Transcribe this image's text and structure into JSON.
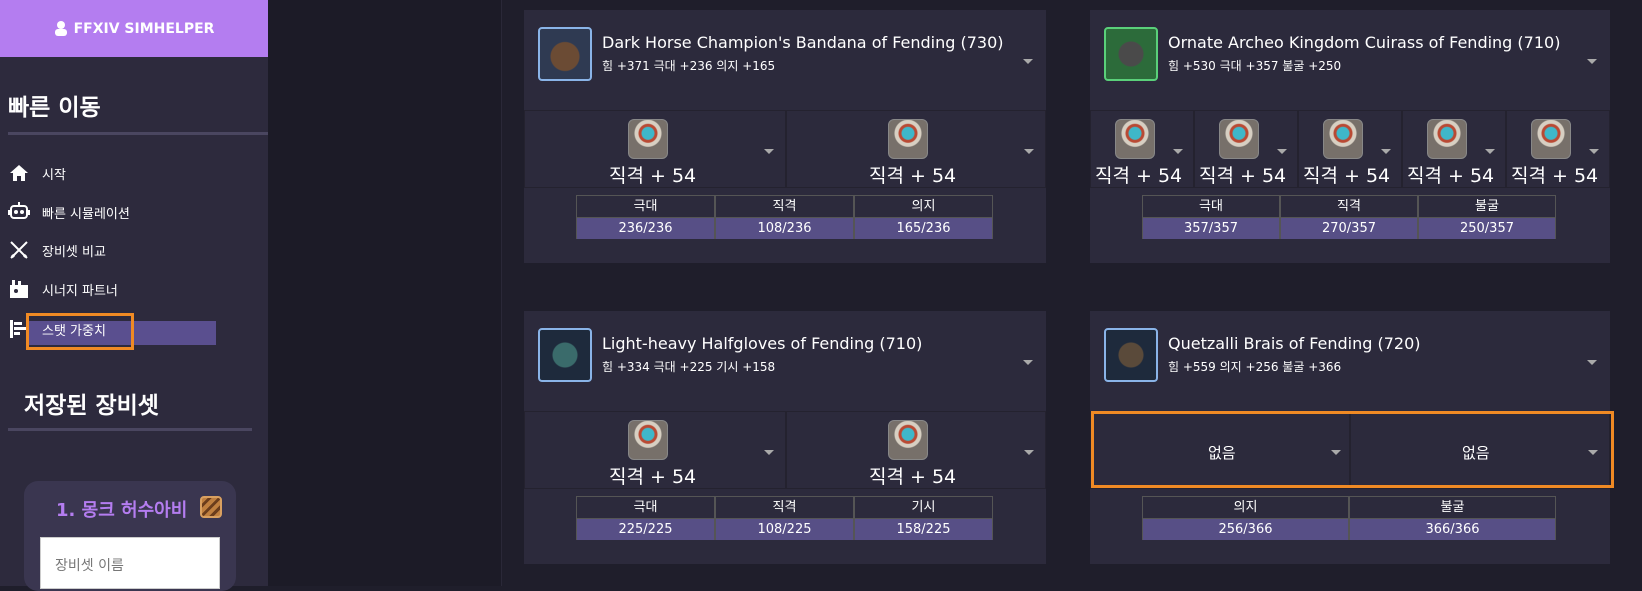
{
  "app": {
    "brand": "FFXIV SIMHELPER"
  },
  "sidebar": {
    "quick_title": "빠른 이동",
    "items": [
      {
        "label": "시작",
        "icon": "home-icon"
      },
      {
        "label": "빠른 시뮬레이션",
        "icon": "robot-icon"
      },
      {
        "label": "장비셋 비교",
        "icon": "crossed-swords-icon"
      },
      {
        "label": "시너지 파트너",
        "icon": "party-icon"
      },
      {
        "label": "스탯 가중치",
        "icon": "bar-chart-icon",
        "selected": true
      }
    ],
    "saved_title": "저장된 장비셋",
    "saved_sets": [
      {
        "name": "1. 몽크 허수아비",
        "name_placeholder": "장비셋 이름"
      }
    ]
  },
  "cards": [
    {
      "name": "Dark Horse Champion's Bandana of Fending (730)",
      "stats": "힘 +371 극대 +236 의지 +165",
      "icon": "bandana-icon",
      "melds": [
        "직격 + 54",
        "직격 + 54"
      ],
      "table": [
        {
          "label": "극대",
          "value": "236/236"
        },
        {
          "label": "직격",
          "value": "108/236"
        },
        {
          "label": "의지",
          "value": "165/236"
        }
      ]
    },
    {
      "name": "Ornate Archeo Kingdom Cuirass of Fending (710)",
      "stats": "힘 +530 극대 +357 불굴 +250",
      "icon": "cuirass-icon",
      "melds": [
        "직격 + 54",
        "직격 + 54",
        "직격 + 54",
        "직격 + 54",
        "직격 + 54"
      ],
      "table": [
        {
          "label": "극대",
          "value": "357/357"
        },
        {
          "label": "직격",
          "value": "270/357"
        },
        {
          "label": "불굴",
          "value": "250/357"
        }
      ]
    },
    {
      "name": "Light-heavy Halfgloves of Fending (710)",
      "stats": "힘 +334 극대 +225 기시 +158",
      "icon": "halfgloves-icon",
      "melds": [
        "직격 + 54",
        "직격 + 54"
      ],
      "table": [
        {
          "label": "극대",
          "value": "225/225"
        },
        {
          "label": "직격",
          "value": "108/225"
        },
        {
          "label": "기시",
          "value": "158/225"
        }
      ]
    },
    {
      "name": "Quetzalli Brais of Fending (720)",
      "stats": "힘 +559 의지 +256 불굴 +366",
      "icon": "brais-icon",
      "melds": [
        "없음",
        "없음"
      ],
      "table": [
        {
          "label": "의지",
          "value": "256/366"
        },
        {
          "label": "불굴",
          "value": "366/366"
        }
      ]
    }
  ],
  "colors": {
    "brand": "#b47df0",
    "highlight": "#f08a24",
    "stat_bar": "#574f86"
  }
}
